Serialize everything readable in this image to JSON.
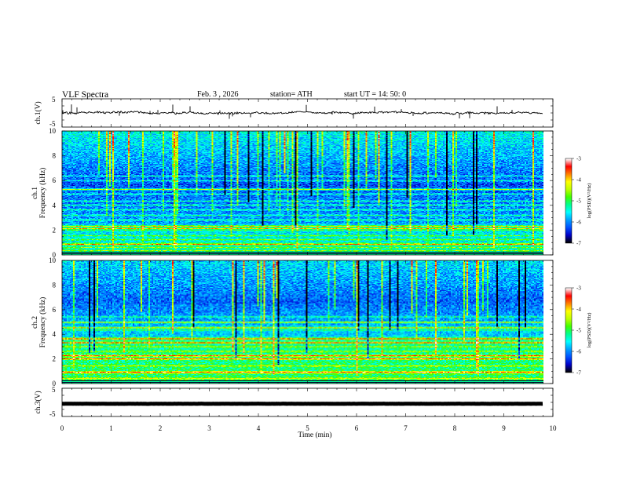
{
  "header": {
    "title": "VLF  Spectra",
    "date": "Feb. 3  , 2026",
    "station": "station= ATH",
    "start": "start  UT  =   14: 50: 0"
  },
  "colors": {
    "trace": "#000000",
    "spectrogram_palette": [
      "#000000",
      "#0000c8",
      "#0050ff",
      "#00a0ff",
      "#00ffff",
      "#00ff90",
      "#40ff00",
      "#c0ff00",
      "#ffff00",
      "#ff8000",
      "#ff0000",
      "#ffffff"
    ]
  },
  "chart_data": [
    {
      "type": "line",
      "panel": "ch1-waveform",
      "ylabel": "ch.1(V)",
      "ylim": [
        -5,
        5
      ],
      "yticks": [
        "5",
        "-5"
      ],
      "baseline_value": 0,
      "description_values": {
        "noise_amplitude_v": 0.6,
        "spike_amplitude_v": 3
      }
    },
    {
      "type": "heatmap",
      "panel": "ch1-spectrogram",
      "ylabel": "ch.1\nFrequency  (kHz)",
      "ylabel_lines": [
        "ch.1",
        "Frequency  (kHz)"
      ],
      "ylim": [
        0,
        10
      ],
      "yticks": [
        "10",
        "8",
        "6",
        "4",
        "2",
        "0"
      ],
      "colorbar": {
        "label": "log(PSD)(V²/Hz)",
        "range": [
          -7,
          -3
        ],
        "ticks": [
          "-3",
          "-4",
          "-5",
          "-6",
          "-7"
        ]
      },
      "bands_khz": [
        0.3,
        0.6,
        0.9,
        1.2,
        1.5,
        2.0,
        2.3,
        2.8,
        3.2,
        3.6,
        4.0,
        4.3,
        4.9,
        5.3,
        6.0,
        6.4
      ],
      "high_bands_khz": [
        0.8,
        2.1,
        2.3,
        5.3
      ]
    },
    {
      "type": "heatmap",
      "panel": "ch2-spectrogram",
      "ylabel": "ch.2\nFrequency  (kHz)",
      "ylabel_lines": [
        "ch.2",
        "Frequency  (kHz)"
      ],
      "ylim": [
        0,
        10
      ],
      "yticks": [
        "10",
        "8",
        "6",
        "4",
        "2",
        "0"
      ],
      "colorbar": {
        "label": "log(PSD)(V²/Hz)",
        "range": [
          -7,
          -3
        ],
        "ticks": [
          "-3",
          "-4",
          "-5",
          "-6",
          "-7"
        ]
      },
      "bands_khz": [
        0.4,
        0.8,
        1.4,
        2.0,
        2.2,
        2.6,
        3.0,
        3.3,
        3.6,
        4.3,
        4.6,
        5.0,
        5.4
      ],
      "high_bands_khz": [
        0.9,
        2.0,
        2.2,
        3.3,
        3.6,
        4.5,
        5.0
      ]
    },
    {
      "type": "line",
      "panel": "ch3-waveform",
      "ylabel": "ch.3(V)",
      "ylim": [
        -5,
        5
      ],
      "yticks": [
        "5",
        "-5"
      ],
      "baseline_value": -0.5,
      "description_values": {
        "noise_amplitude_v": 0.05,
        "spike_amplitude_v": 0
      }
    }
  ],
  "xaxis": {
    "label": "Time  (min)",
    "range": [
      0,
      10
    ],
    "data_end_min": 9.8,
    "ticks": [
      "0",
      "1",
      "2",
      "3",
      "4",
      "5",
      "6",
      "7",
      "8",
      "9",
      "10"
    ]
  }
}
